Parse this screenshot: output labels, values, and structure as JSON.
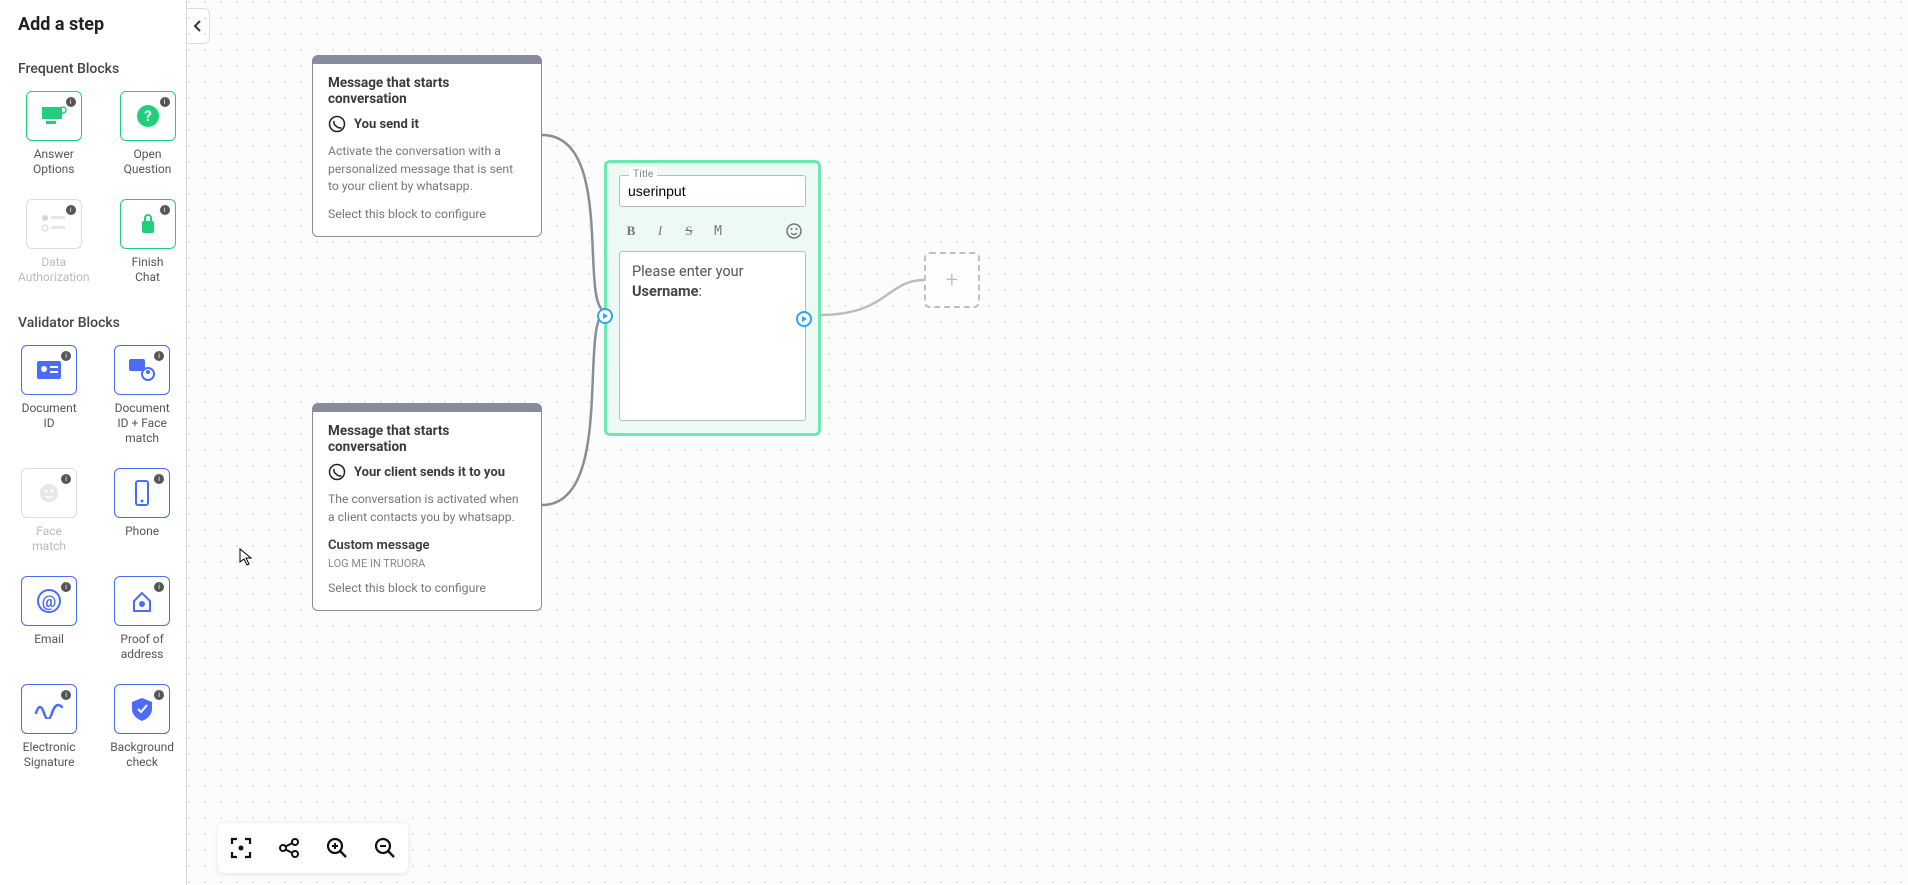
{
  "sidebar": {
    "title": "Add a step",
    "sections": [
      {
        "title": "Frequent Blocks",
        "items": [
          {
            "label": "Answer Options",
            "icon": "answer-options",
            "color": "green",
            "enabled": true
          },
          {
            "label": "Open Question",
            "icon": "open-question",
            "color": "green",
            "enabled": true
          },
          {
            "label": "Data Authorization",
            "icon": "data-auth",
            "color": "gray",
            "enabled": false
          },
          {
            "label": "Finish Chat",
            "icon": "finish-chat",
            "color": "green",
            "enabled": true
          }
        ]
      },
      {
        "title": "Validator Blocks",
        "items": [
          {
            "label": "Document ID",
            "icon": "doc-id",
            "color": "blue",
            "enabled": true
          },
          {
            "label": "Document ID + Face match",
            "icon": "doc-face",
            "color": "blue",
            "enabled": true
          },
          {
            "label": "Face match",
            "icon": "face-match",
            "color": "gray",
            "enabled": false
          },
          {
            "label": "Phone",
            "icon": "phone",
            "color": "blue",
            "enabled": true
          },
          {
            "label": "Email",
            "icon": "email",
            "color": "blue",
            "enabled": true
          },
          {
            "label": "Proof of address",
            "icon": "address",
            "color": "blue",
            "enabled": true
          },
          {
            "label": "Electronic Signature",
            "icon": "signature",
            "color": "blue",
            "enabled": true
          },
          {
            "label": "Background check",
            "icon": "bgcheck",
            "color": "blue",
            "enabled": true
          }
        ]
      }
    ]
  },
  "nodes": {
    "start_a": {
      "title": "Message that starts conversation",
      "subtitle": "You send it",
      "desc": "Activate the conversation with a personalized message that is sent to your client by whatsapp.",
      "hint": "Select this block to configure"
    },
    "start_b": {
      "title": "Message that starts conversation",
      "subtitle": "Your client sends it to you",
      "desc": "The conversation is activated when a client contacts you by whatsapp.",
      "custom_title": "Custom message",
      "custom_msg": "LOG ME IN TRUORA",
      "hint": "Select this block to configure"
    },
    "editor": {
      "title_label": "Title",
      "title_value": "userinput",
      "body_prefix": "Please enter your ",
      "body_bold": "Username",
      "body_suffix": ":"
    }
  },
  "toolbar": {
    "fit": "fit-view",
    "share": "share",
    "zoom_in": "zoom-in",
    "zoom_out": "zoom-out"
  }
}
